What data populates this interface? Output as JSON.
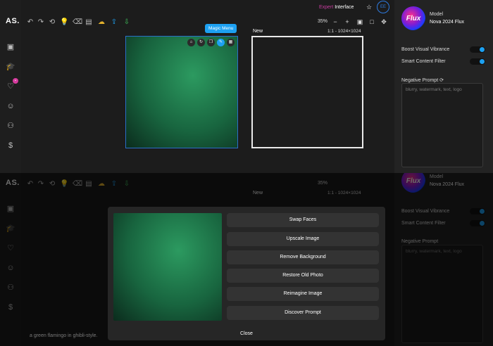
{
  "app": {
    "logo_text": "AS."
  },
  "top_bar": {
    "expert_label_1": "Expert",
    "expert_label_2": "Interface",
    "avatar_initials": "EE"
  },
  "canvas": {
    "zoom": "35%",
    "new_label": "New",
    "ratio_label": "1:1 - 1024×1024",
    "magic_tooltip": "Magic Menu",
    "mini_toolbar_icons": [
      "home-icon",
      "refresh-icon",
      "layers-icon",
      "magic-wand-icon",
      "image-icon"
    ]
  },
  "right_panel": {
    "model_logo_text": "Flux",
    "model_label": "Model",
    "model_name": "Nova 2024 Flux",
    "toggles": [
      {
        "label": "Boost Visual Vibrance",
        "on": true
      },
      {
        "label": "Smart Content Filter",
        "on": true
      }
    ],
    "negative_prompt_label": "Negative Prompt",
    "negative_prompt_placeholder": "blurry, watermark, text, logo"
  },
  "modal": {
    "buttons": [
      "Swap Faces",
      "Upscale Image",
      "Remove Background",
      "Restore Old Photo",
      "Reimagine Image",
      "Discover Prompt"
    ],
    "close_label": "Close"
  },
  "prompt_caption": "a green flamingo in ghibli-style.",
  "colors": {
    "accent": "#1da1f2",
    "brand_pink": "#d63b9e",
    "selection_blue": "#2a6ec9"
  }
}
